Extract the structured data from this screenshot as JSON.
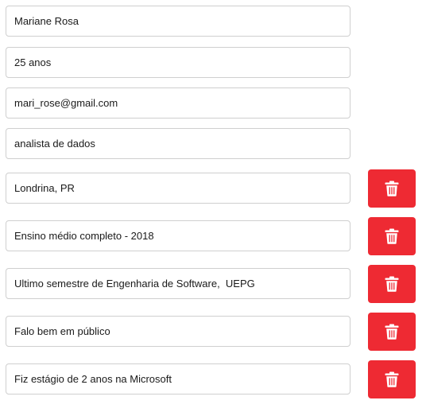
{
  "fields": [
    {
      "value": "Mariane Rosa"
    },
    {
      "value": "25 anos"
    },
    {
      "value": "mari_rose@gmail.com"
    },
    {
      "value": "analista de dados"
    },
    {
      "value": "Londrina, PR"
    },
    {
      "value": "Ensino médio completo - 2018"
    },
    {
      "value": "Ultimo semestre de Engenharia de Software,  UEPG"
    },
    {
      "value": "Falo bem em público"
    },
    {
      "value": "Fiz estágio de 2 anos na Microsoft"
    }
  ],
  "delete_button": {
    "icon": "trash-icon",
    "color": "#ee2a33"
  }
}
